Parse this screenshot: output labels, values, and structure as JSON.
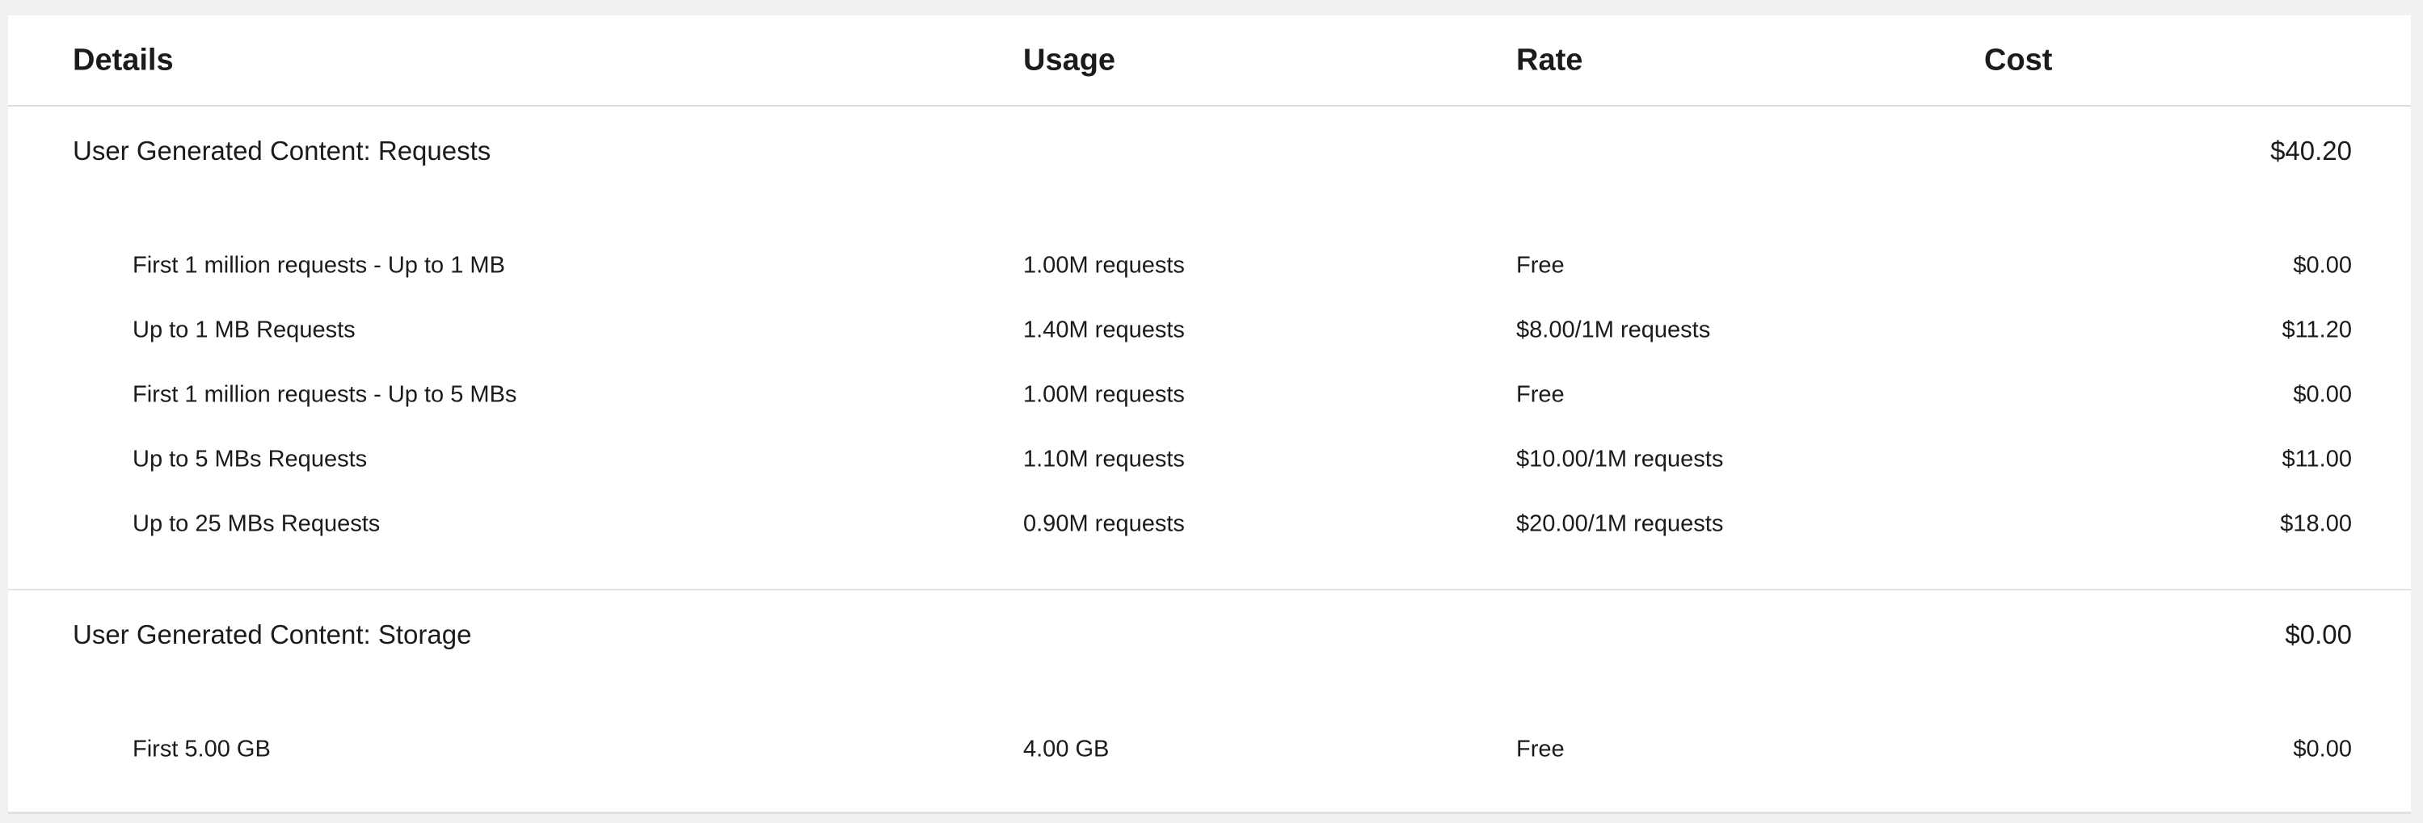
{
  "header": {
    "details": "Details",
    "usage": "Usage",
    "rate": "Rate",
    "cost": "Cost"
  },
  "groups": [
    {
      "title": "User Generated Content: Requests",
      "total": "$40.20",
      "rows": [
        {
          "details": "First 1 million requests - Up to 1 MB",
          "usage": "1.00M requests",
          "rate": "Free",
          "cost": "$0.00"
        },
        {
          "details": "Up to 1 MB Requests",
          "usage": "1.40M requests",
          "rate": "$8.00/1M requests",
          "cost": "$11.20"
        },
        {
          "details": "First 1 million requests - Up to 5 MBs",
          "usage": "1.00M requests",
          "rate": "Free",
          "cost": "$0.00"
        },
        {
          "details": "Up to 5 MBs Requests",
          "usage": "1.10M requests",
          "rate": "$10.00/1M requests",
          "cost": "$11.00"
        },
        {
          "details": "Up to 25 MBs Requests",
          "usage": "0.90M requests",
          "rate": "$20.00/1M requests",
          "cost": "$18.00"
        }
      ]
    },
    {
      "title": "User Generated Content: Storage",
      "total": "$0.00",
      "rows": [
        {
          "details": "First 5.00 GB",
          "usage": "4.00 GB",
          "rate": "Free",
          "cost": "$0.00"
        }
      ]
    }
  ]
}
